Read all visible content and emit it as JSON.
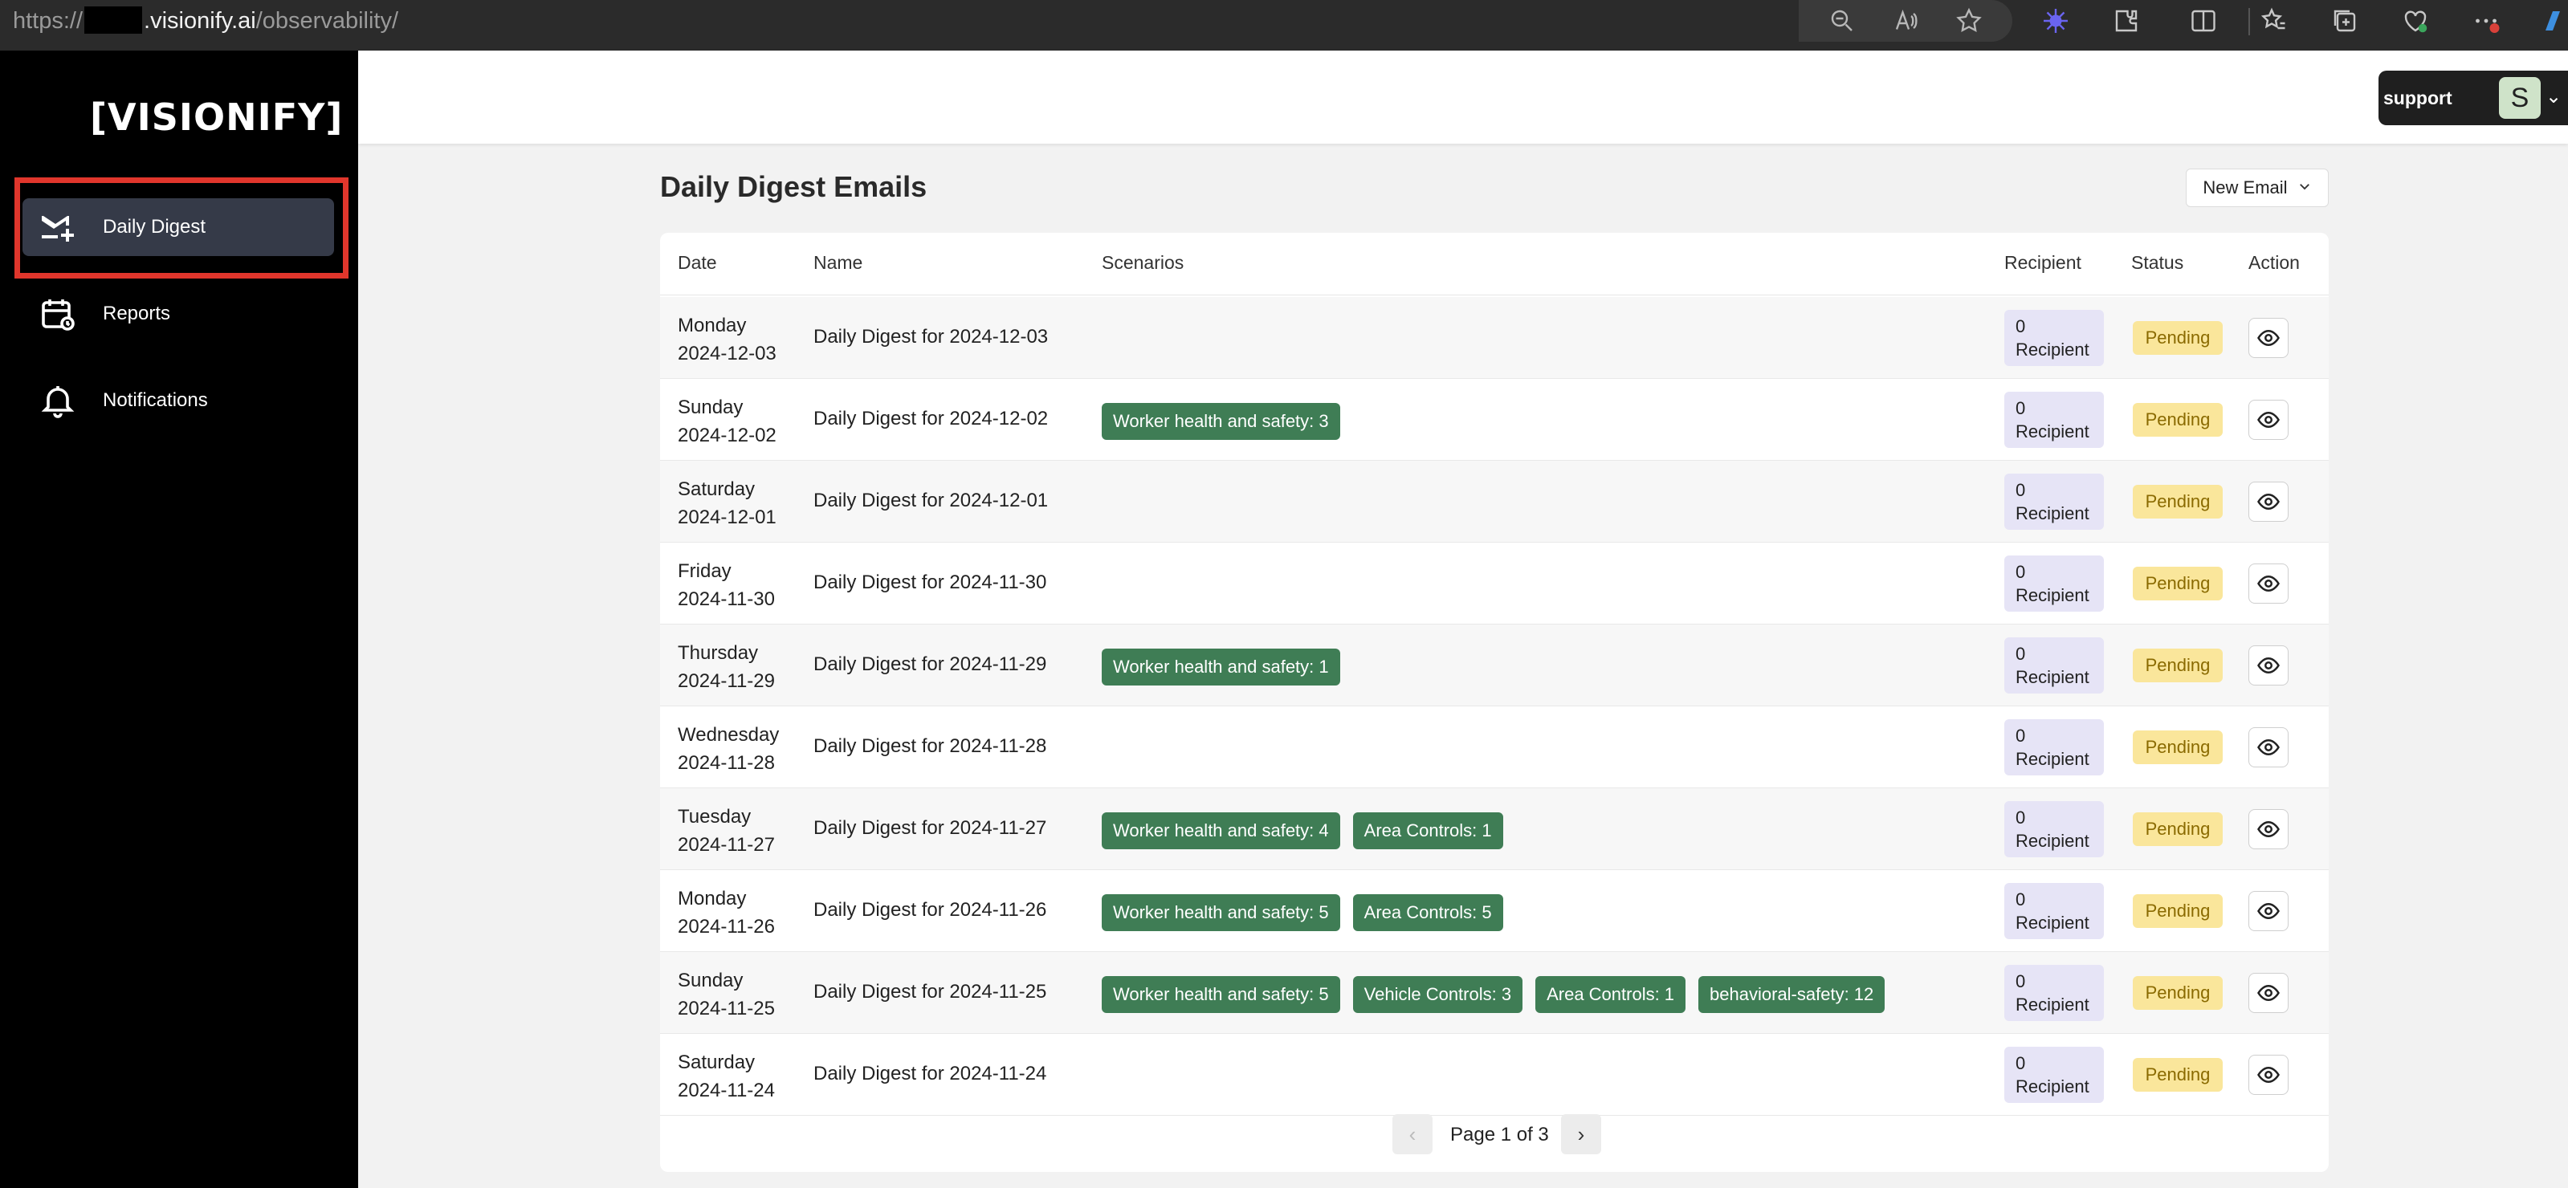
{
  "browser": {
    "url_scheme": "https://",
    "url_host": ".visionify.ai",
    "url_path": "/observability/"
  },
  "app": {
    "logo": "[VISIONIFY]"
  },
  "sidebar": {
    "items": [
      {
        "label": "Daily Digest",
        "icon": "mail-plus-icon",
        "active": true
      },
      {
        "label": "Reports",
        "icon": "calendar-icon",
        "active": false
      },
      {
        "label": "Notifications",
        "icon": "bell-icon",
        "active": false
      }
    ]
  },
  "user": {
    "name": "support",
    "avatar_letter": "S"
  },
  "main": {
    "title": "Daily Digest Emails",
    "new_email_label": "New Email",
    "columns": [
      "Date",
      "Name",
      "Scenarios",
      "Recipient",
      "Status",
      "Action"
    ],
    "rows": [
      {
        "day": "Monday",
        "date": "2024-12-03",
        "name": "Daily Digest for 2024-12-03",
        "scenarios": [],
        "recipients": "0",
        "recipient_label": "Recipient",
        "status": "Pending"
      },
      {
        "day": "Sunday",
        "date": "2024-12-02",
        "name": "Daily Digest for 2024-12-02",
        "scenarios": [
          "Worker health and safety: 3"
        ],
        "recipients": "0",
        "recipient_label": "Recipient",
        "status": "Pending"
      },
      {
        "day": "Saturday",
        "date": "2024-12-01",
        "name": "Daily Digest for 2024-12-01",
        "scenarios": [],
        "recipients": "0",
        "recipient_label": "Recipient",
        "status": "Pending"
      },
      {
        "day": "Friday",
        "date": "2024-11-30",
        "name": "Daily Digest for 2024-11-30",
        "scenarios": [],
        "recipients": "0",
        "recipient_label": "Recipient",
        "status": "Pending"
      },
      {
        "day": "Thursday",
        "date": "2024-11-29",
        "name": "Daily Digest for 2024-11-29",
        "scenarios": [
          "Worker health and safety: 1"
        ],
        "recipients": "0",
        "recipient_label": "Recipient",
        "status": "Pending"
      },
      {
        "day": "Wednesday",
        "date": "2024-11-28",
        "name": "Daily Digest for 2024-11-28",
        "scenarios": [],
        "recipients": "0",
        "recipient_label": "Recipient",
        "status": "Pending"
      },
      {
        "day": "Tuesday",
        "date": "2024-11-27",
        "name": "Daily Digest for 2024-11-27",
        "scenarios": [
          "Worker health and safety: 4",
          "Area Controls: 1"
        ],
        "recipients": "0",
        "recipient_label": "Recipient",
        "status": "Pending"
      },
      {
        "day": "Monday",
        "date": "2024-11-26",
        "name": "Daily Digest for 2024-11-26",
        "scenarios": [
          "Worker health and safety: 5",
          "Area Controls: 5"
        ],
        "recipients": "0",
        "recipient_label": "Recipient",
        "status": "Pending"
      },
      {
        "day": "Sunday",
        "date": "2024-11-25",
        "name": "Daily Digest for 2024-11-25",
        "scenarios": [
          "Worker health and safety: 5",
          "Vehicle Controls: 3",
          "Area Controls: 1",
          "behavioral-safety: 12"
        ],
        "recipients": "0",
        "recipient_label": "Recipient",
        "status": "Pending"
      },
      {
        "day": "Saturday",
        "date": "2024-11-24",
        "name": "Daily Digest for 2024-11-24",
        "scenarios": [],
        "recipients": "0",
        "recipient_label": "Recipient",
        "status": "Pending"
      }
    ],
    "pagination": {
      "text": "Page 1 of 3",
      "prev_symbol": "‹",
      "next_symbol": "›"
    }
  },
  "colors": {
    "sidebar_bg": "#000000",
    "active_nav_bg": "#353a48",
    "highlight_border": "#e0362c",
    "tag_bg": "#3f7d55",
    "status_bg": "#fae69b",
    "recipient_bg": "#e6e4f6"
  }
}
